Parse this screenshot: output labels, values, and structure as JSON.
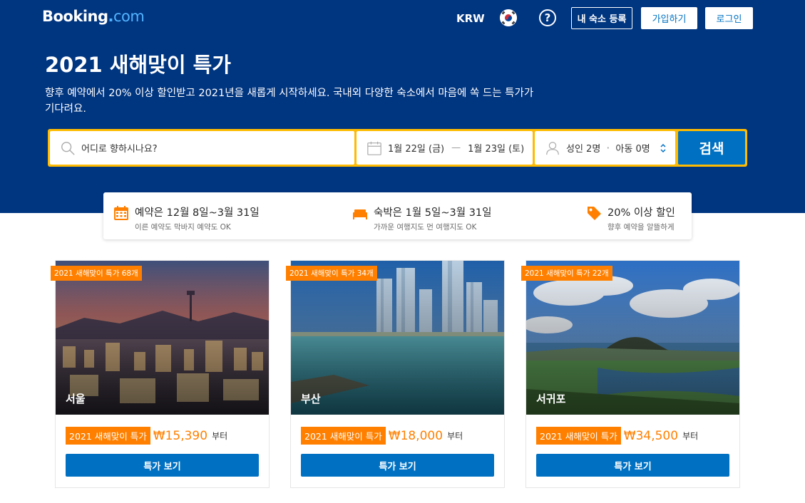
{
  "header": {
    "logo_main": "Booking",
    "logo_dot": ".",
    "logo_com": "com",
    "currency": "KRW",
    "help": "?",
    "list_property": "내 숙소 등록",
    "register": "가입하기",
    "sign_in": "로그인"
  },
  "hero": {
    "title": "2021 새해맞이 특가",
    "subtitle": "향후 예약에서 20% 이상 할인받고 2021년을 새롭게 시작하세요. 국내외 다양한 숙소에서 마음에 쏙 드는 특가가 기다려요."
  },
  "search": {
    "destination_placeholder": "어디로 향하시나요?",
    "checkin": "1월 22일 (금)",
    "dash": "—",
    "checkout": "1월 23일 (토)",
    "adults": "성인 2명",
    "sep": "·",
    "children": "아동 0명",
    "button": "검색"
  },
  "info": [
    {
      "title": "예약은 12월 8일~3월 31일",
      "desc": "이른 예약도 막바지 예약도 OK",
      "icon": "calendar-icon"
    },
    {
      "title": "숙박은 1월 5일~3월 31일",
      "desc": "가까운 여행지도 먼 여행지도 OK",
      "icon": "bed-icon"
    },
    {
      "title": "20% 이상 할인",
      "desc": "향후 예약을 알뜰하게",
      "icon": "tag-icon"
    }
  ],
  "cards": [
    {
      "badge": "2021 새해맞이 특가 68개",
      "city": "서울",
      "deal": "2021 새해맞이 특가",
      "price": "₩15,390",
      "suffix": "부터",
      "button": "특가 보기"
    },
    {
      "badge": "2021 새해맞이 특가 34개",
      "city": "부산",
      "deal": "2021 새해맞이 특가",
      "price": "₩18,000",
      "suffix": "부터",
      "button": "특가 보기"
    },
    {
      "badge": "2021 새해맞이 특가 22개",
      "city": "서귀포",
      "deal": "2021 새해맞이 특가",
      "price": "₩34,500",
      "suffix": "부터",
      "button": "특가 보기"
    }
  ],
  "colors": {
    "brand_blue": "#003580",
    "action_blue": "#0071c2",
    "accent_yellow": "#febb02",
    "deal_orange": "#ff8000"
  }
}
